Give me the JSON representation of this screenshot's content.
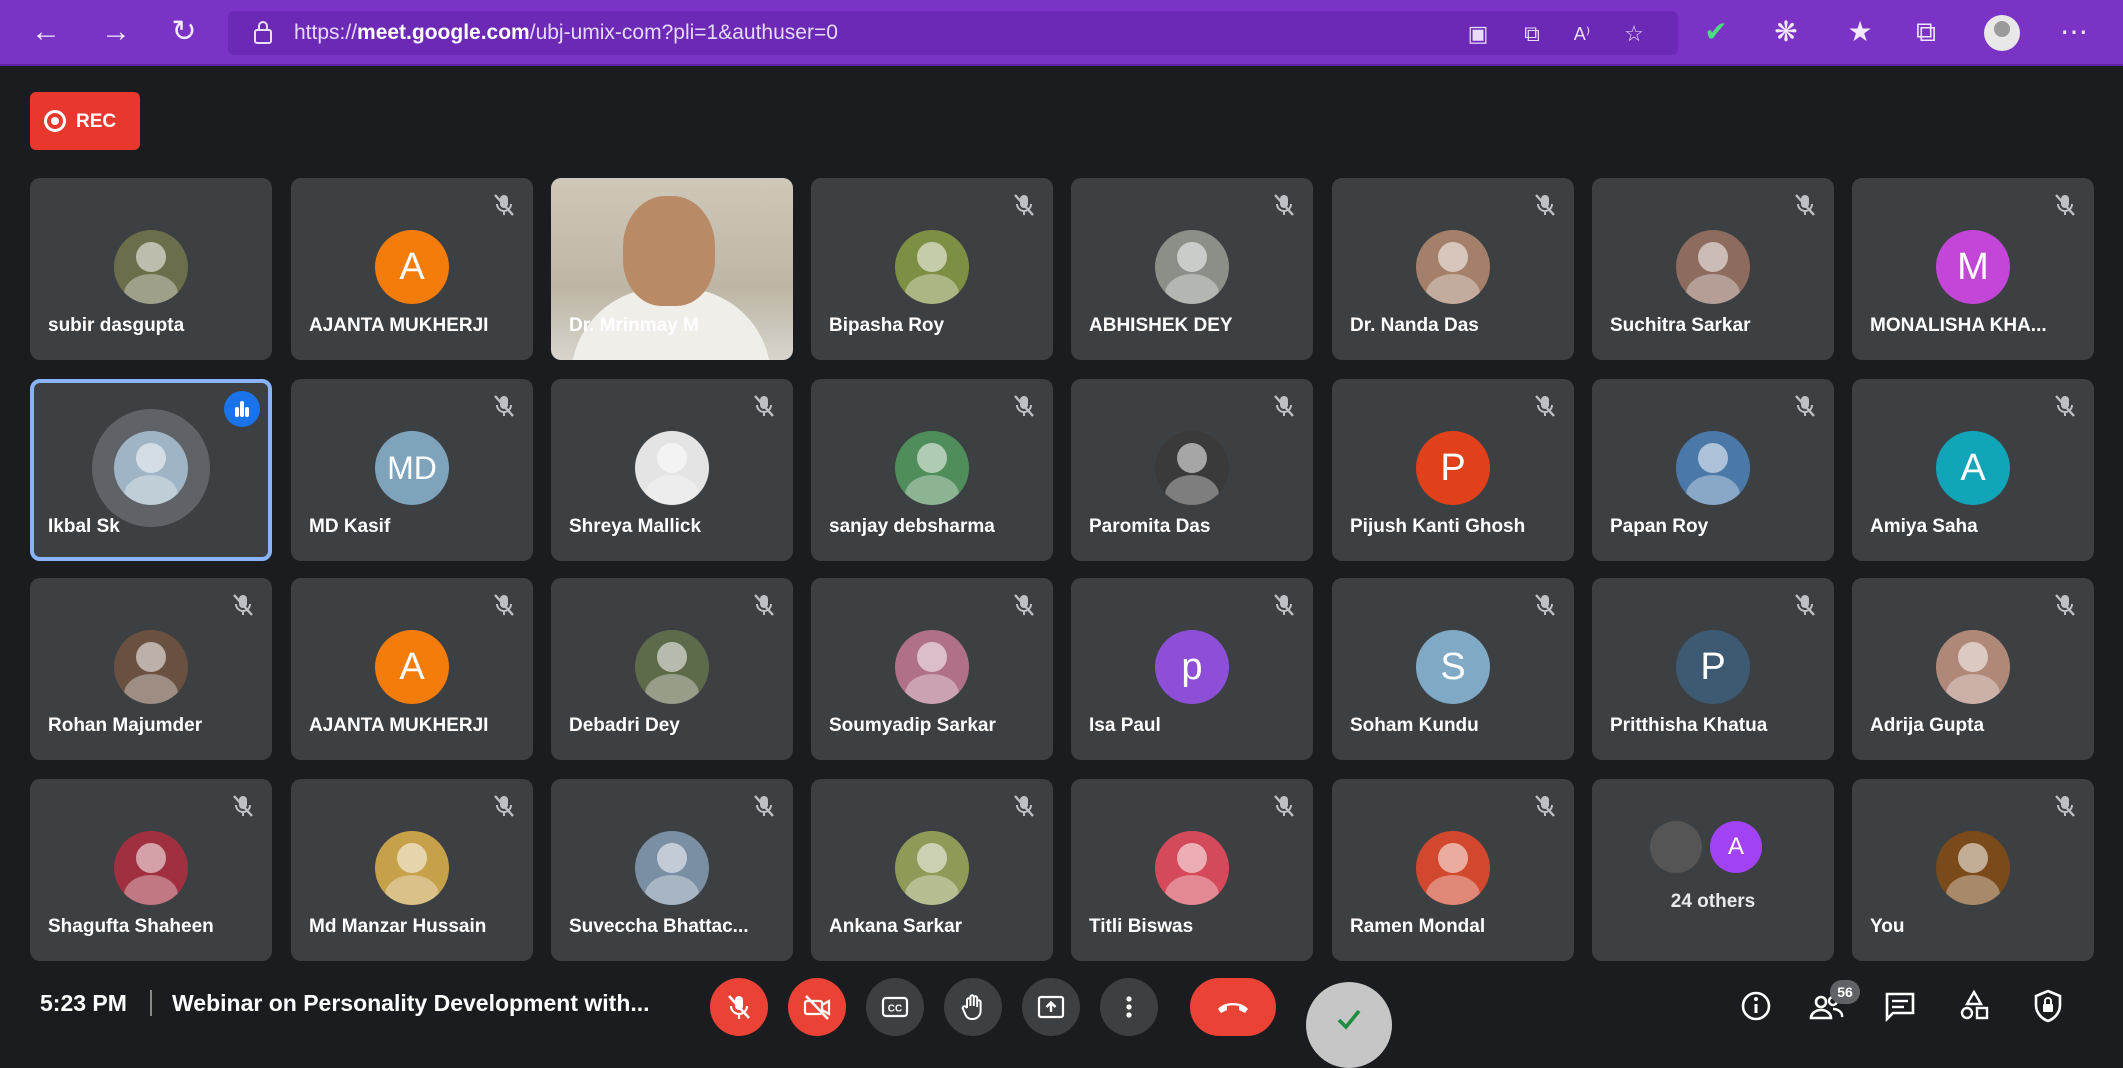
{
  "browser": {
    "url_prefix": "https://",
    "url_host": "meet.google.com",
    "url_path": "/ubj-umix-com?pli=1&authuser=0"
  },
  "rec_label": "REC",
  "tiles": [
    {
      "name": "subir dasgupta",
      "type": "photo",
      "color": "#6b6e4a",
      "muted": false
    },
    {
      "name": "AJANTA MUKHERJI",
      "type": "letter",
      "letter": "A",
      "color": "#f47c0b",
      "muted": true
    },
    {
      "name": "Dr. Mrinmay M",
      "type": "video",
      "muted": false
    },
    {
      "name": "Bipasha Roy",
      "type": "photo",
      "color": "#7d8f43",
      "muted": true
    },
    {
      "name": "ABHISHEK DEY",
      "type": "photo",
      "color": "#8a8f87",
      "muted": true
    },
    {
      "name": "Dr. Nanda Das",
      "type": "photo",
      "color": "#a4806a",
      "muted": true
    },
    {
      "name": "Suchitra Sarkar",
      "type": "photo",
      "color": "#8d6b5e",
      "muted": true
    },
    {
      "name": "MONALISHA KHA...",
      "type": "letter",
      "letter": "M",
      "color": "#c446d8",
      "muted": true
    },
    {
      "name": "Ikbal Sk",
      "type": "photo",
      "color": "#9fb4c4",
      "muted": false,
      "speaking": true
    },
    {
      "name": "MD Kasif",
      "type": "letter",
      "letter": "MD",
      "color": "#7ea3bb",
      "muted": true
    },
    {
      "name": "Shreya Mallick",
      "type": "photo",
      "color": "#e4e4e4",
      "muted": true
    },
    {
      "name": "sanjay debsharma",
      "type": "photo",
      "color": "#4f8d5a",
      "muted": true
    },
    {
      "name": "Paromita Das",
      "type": "photo",
      "color": "#3a3a3a",
      "muted": true
    },
    {
      "name": "Pijush Kanti Ghosh",
      "type": "letter",
      "letter": "P",
      "color": "#e0401a",
      "muted": true
    },
    {
      "name": "Papan Roy",
      "type": "photo",
      "color": "#4a78a8",
      "muted": true
    },
    {
      "name": "Amiya Saha",
      "type": "letter",
      "letter": "A",
      "color": "#12a4b8",
      "muted": true
    },
    {
      "name": "Rohan Majumder",
      "type": "photo",
      "color": "#6a5040",
      "muted": true
    },
    {
      "name": "AJANTA MUKHERJI",
      "type": "letter",
      "letter": "A",
      "color": "#f47c0b",
      "muted": true
    },
    {
      "name": "Debadri Dey",
      "type": "photo",
      "color": "#5e6b4a",
      "muted": true
    },
    {
      "name": "Soumyadip Sarkar",
      "type": "photo",
      "color": "#b0708a",
      "muted": true
    },
    {
      "name": "Isa Paul",
      "type": "letter",
      "letter": "p",
      "color": "#8e4fd8",
      "muted": true
    },
    {
      "name": "Soham Kundu",
      "type": "letter",
      "letter": "S",
      "color": "#7fa9c4",
      "muted": true
    },
    {
      "name": "Pritthisha Khatua",
      "type": "letter",
      "letter": "P",
      "color": "#3d5a72",
      "muted": true
    },
    {
      "name": "Adrija Gupta",
      "type": "photo",
      "color": "#b08878",
      "muted": true
    },
    {
      "name": "Shagufta Shaheen",
      "type": "photo",
      "color": "#a03040",
      "muted": true
    },
    {
      "name": "Md Manzar Hussain",
      "type": "photo",
      "color": "#c7a04a",
      "muted": true
    },
    {
      "name": "Suveccha Bhattac...",
      "type": "photo",
      "color": "#7a8fa4",
      "muted": true
    },
    {
      "name": "Ankana Sarkar",
      "type": "photo",
      "color": "#8f9a58",
      "muted": true
    },
    {
      "name": "Titli Biswas",
      "type": "photo",
      "color": "#d44a5a",
      "muted": true
    },
    {
      "name": "Ramen Mondal",
      "type": "photo",
      "color": "#d2482e",
      "muted": true
    },
    {
      "name": "",
      "type": "others",
      "label": "24 others",
      "letter": "A",
      "muted": false
    },
    {
      "name": "You",
      "type": "photo",
      "color": "#7a4a1a",
      "muted": true
    }
  ],
  "bottom": {
    "time": "5:23 PM",
    "meeting_title": "Webinar on Personality Development with...",
    "participant_count": "56"
  }
}
